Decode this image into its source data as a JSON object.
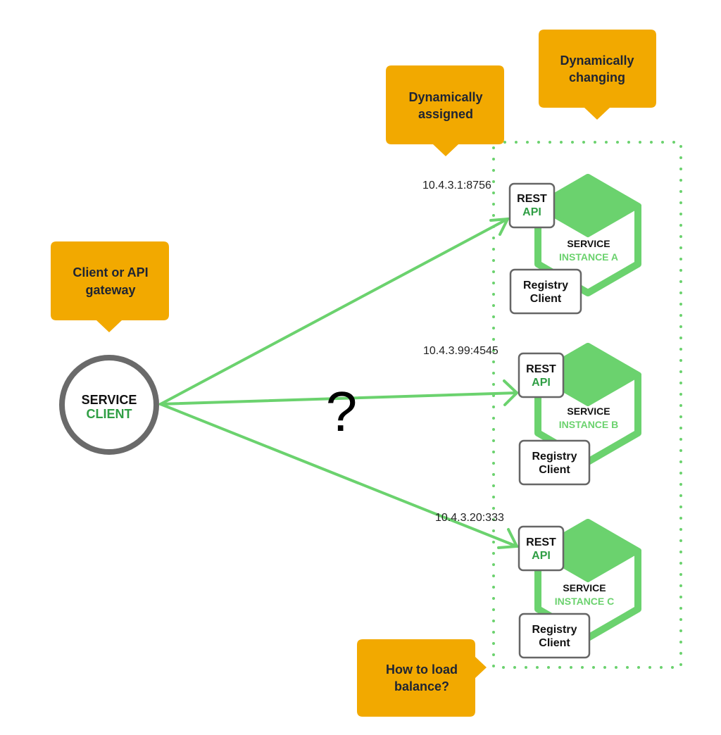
{
  "colors": {
    "callout": "#f2a900",
    "green": "#6bd26e",
    "green_text": "#2f9e44",
    "box_border": "#666666",
    "circle_border": "#6a6a6a"
  },
  "callouts": {
    "client_gateway": {
      "line1": "Client or API",
      "line2": "gateway"
    },
    "dyn_assigned": {
      "line1": "Dynamically",
      "line2": "assigned"
    },
    "dyn_changing": {
      "line1": "Dynamically",
      "line2": "changing"
    },
    "load_balance": {
      "line1": "How to load",
      "line2": "balance?"
    }
  },
  "service_client": {
    "line1": "SERVICE",
    "line2": "CLIENT"
  },
  "question_mark": "?",
  "instances": [
    {
      "address": "10.4.3.1:8756",
      "rest_line1": "REST",
      "rest_line2": "API",
      "svc_line1": "SERVICE",
      "svc_line2": "INSTANCE A",
      "registry_line1": "Registry",
      "registry_line2": "Client"
    },
    {
      "address": "10.4.3.99:4545",
      "rest_line1": "REST",
      "rest_line2": "API",
      "svc_line1": "SERVICE",
      "svc_line2": "INSTANCE B",
      "registry_line1": "Registry",
      "registry_line2": "Client"
    },
    {
      "address": "10.4.3.20:333",
      "rest_line1": "REST",
      "rest_line2": "API",
      "svc_line1": "SERVICE",
      "svc_line2": "INSTANCE C",
      "registry_line1": "Registry",
      "registry_line2": "Client"
    }
  ]
}
